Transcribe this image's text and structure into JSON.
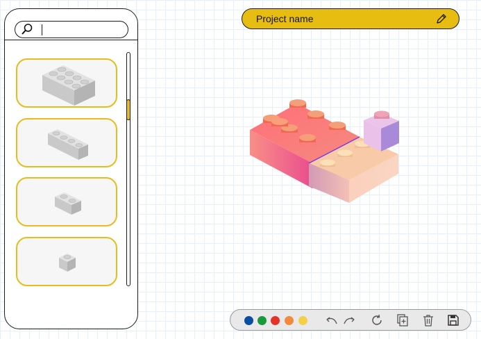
{
  "sidebar": {
    "search": {
      "value": "",
      "placeholder": ""
    },
    "bricks": [
      {
        "name": "brick-2x4"
      },
      {
        "name": "brick-1x4"
      },
      {
        "name": "brick-1x2"
      },
      {
        "name": "brick-1x1"
      }
    ]
  },
  "header": {
    "project_name": "Project name"
  },
  "toolbar": {
    "colors": [
      "#0a4ea3",
      "#1a9a3c",
      "#e5332a",
      "#f08a3c",
      "#f3d04a"
    ],
    "icons": [
      "undo-icon",
      "redo-icon",
      "refresh-icon",
      "add-copy-icon",
      "trash-icon",
      "save-icon"
    ]
  },
  "accent": "#e6bd1a"
}
